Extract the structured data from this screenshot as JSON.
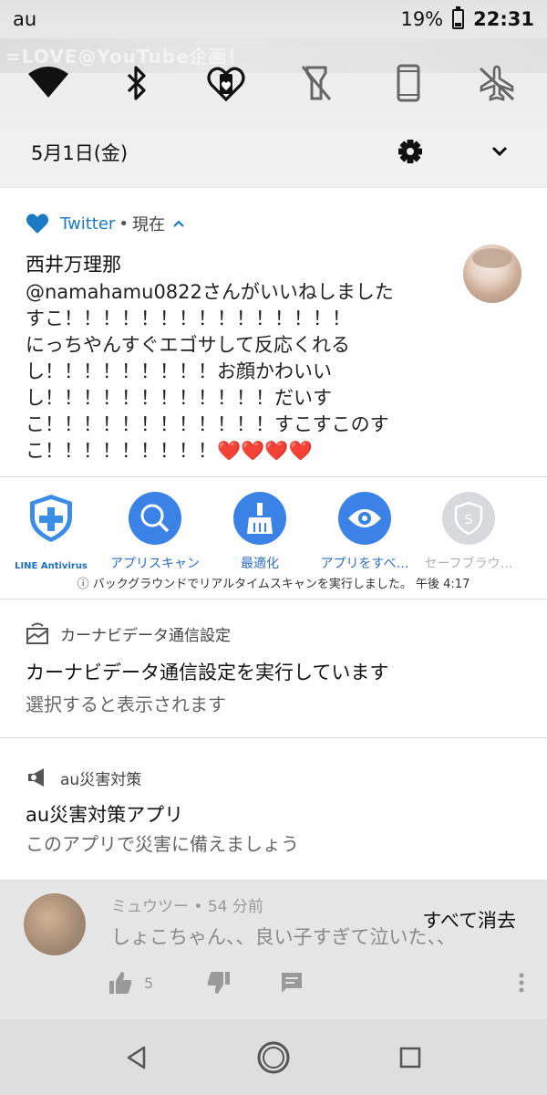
{
  "status_bar": {
    "carrier": "au",
    "battery_percent": "19%",
    "time": "22:31"
  },
  "background_banner": "=LOVE@YouTube企画!",
  "quick_settings": {
    "tiles": [
      {
        "icon": "wifi-icon",
        "active": true
      },
      {
        "icon": "bluetooth-icon",
        "active": true
      },
      {
        "icon": "heart-phone-icon",
        "active": true
      },
      {
        "icon": "flashlight-off-icon",
        "active": false
      },
      {
        "icon": "phone-rotate-icon",
        "active": false
      },
      {
        "icon": "airplane-off-icon",
        "active": false
      }
    ],
    "date": "5月1日(金)"
  },
  "twitter_notification": {
    "app_name": "Twitter",
    "separator": "•",
    "time": "現在",
    "title": "西井万理那",
    "body": "@namahamu0822さんがいいねしました\nすこ！！！！！！！！！！！！！！！\nにっちやんすぐエゴサして反応くれる\nし！！！！！！！！！お顔かわいい\nし！！！！！！！！！！！！だいす\nこ！！！！！！！！！！！！すこすこのす\nこ！！！！！！！！！❤️❤️❤️❤️",
    "accent_color": "#1b7bc2"
  },
  "antivirus_notification": {
    "items": [
      {
        "label": "LINE Antivirus",
        "icon": "line-antivirus-shield-icon"
      },
      {
        "label": "アプリスキャン",
        "icon": "magnifier-icon"
      },
      {
        "label": "最適化",
        "icon": "broom-icon"
      },
      {
        "label": "アプリをすべ…",
        "icon": "eye-icon"
      },
      {
        "label": "セーフブラウ…",
        "icon": "safe-browsing-shield-icon"
      }
    ],
    "footer": "ⓘ バックグラウンドでリアルタイムスキャンを実行しました。 午後 4:17",
    "accent_color": "#3b82e6"
  },
  "carnavi_notification": {
    "app_name": "カーナビデータ通信設定",
    "title": "カーナビデータ通信設定を実行しています",
    "subtitle": "選択すると表示されます"
  },
  "au_notification": {
    "app_name": "au災害対策",
    "title": "au災害対策アプリ",
    "subtitle": "このアプリで災害に備えましょう"
  },
  "background_comment": {
    "meta": "ミュウツー • 54 分前",
    "text": "しょこちゃん、、良い子すぎて泣いた、、",
    "like_count": "5"
  },
  "clear_all_label": "すべて消去"
}
